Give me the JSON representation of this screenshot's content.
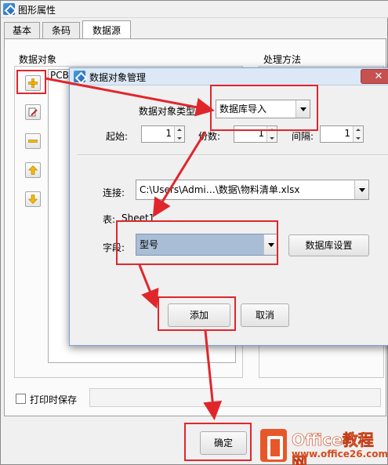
{
  "window": {
    "title": "图形属性",
    "tabs": [
      "基本",
      "条码",
      "数据源"
    ],
    "active_tab": "数据源"
  },
  "datasource": {
    "data_object_label": "数据对象",
    "list_item": "PCB",
    "processing_label": "处理方法",
    "side_buttons": [
      "add-icon",
      "edit-icon",
      "remove-icon",
      "move-up-icon",
      "move-down-icon"
    ],
    "print_save_label": "打印时保存",
    "print_save_checked": false
  },
  "dialog": {
    "title": "数据对象管理",
    "type_label": "数据对象类型:",
    "type_value": "数据库导入",
    "start_label": "起始:",
    "start_value": "1",
    "copies_label": "份数:",
    "copies_value": "1",
    "interval_label": "间隔:",
    "interval_value": "1",
    "connection_label": "连接:",
    "connection_value": "C:\\Users\\Admi…\\数据\\物料清单.xlsx",
    "table_label": "表:",
    "table_value": "Sheet1",
    "field_label": "字段:",
    "field_value": "型号",
    "db_settings_button": "数据库设置",
    "add_button": "添加",
    "cancel_button": "取消"
  },
  "footer": {
    "ok_button": "确定"
  },
  "watermark": {
    "brand": "Office教程网",
    "url": "www.office26.com"
  },
  "colors": {
    "annotation_red": "#e0262b",
    "selected_field_bg": "#a9bed6",
    "dialog_title_bg": "#dce8f6",
    "close_button": "#c75050"
  }
}
